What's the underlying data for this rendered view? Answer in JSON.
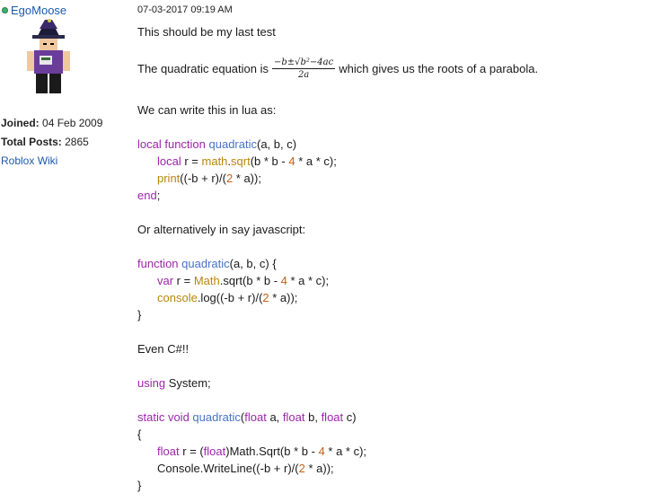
{
  "sidebar": {
    "username": "EgoMoose",
    "joined_label": "Joined:",
    "joined_value": "04 Feb 2009",
    "posts_label": "Total Posts:",
    "posts_value": "2865",
    "wiki_link": "Roblox Wiki"
  },
  "post": {
    "timestamp": "07-03-2017 09:19 AM",
    "line1": "This should be my last test",
    "formula_prefix": "The quadratic equation is",
    "formula_numerator": "−b±√b²−4ac",
    "formula_denominator": "2a",
    "formula_suffix": "which gives us the roots of a parabola.",
    "line_lua_intro": "We can write this in lua as:",
    "line_js_intro": "Or alternatively in say javascript:",
    "line_cs_intro": "Even C#!!"
  },
  "code": {
    "lua": [
      [
        "local function ",
        "quadratic",
        "(a, b, c)"
      ],
      [
        "local",
        " r = ",
        "math",
        ".",
        "sqrt",
        "(b * b - ",
        "4",
        " * a * c);"
      ],
      [
        "print",
        "((-b + r)/(",
        "2",
        " * a));"
      ],
      [
        "end",
        ";"
      ]
    ],
    "js": [
      [
        "function ",
        "quadratic",
        "(a, b, c) {"
      ],
      [
        "var",
        " r = ",
        "Math",
        ".sqrt(b * b - ",
        "4",
        " * a * c);"
      ],
      [
        "console",
        ".log((-b + r)/(",
        "2",
        " * a));"
      ],
      [
        "}"
      ]
    ],
    "cs": [
      [
        "using",
        " System;"
      ],
      [
        "static void ",
        "quadratic",
        "(",
        "float",
        " a, ",
        "float",
        " b, ",
        "float",
        " c)"
      ],
      [
        "{"
      ],
      [
        "float",
        " r = (",
        "float",
        ")Math.Sqrt(b * b - ",
        "4",
        " * a * c);"
      ],
      [
        "Console.WriteLine((-b + r)/(",
        "2",
        " * a));"
      ],
      [
        "}"
      ]
    ]
  }
}
